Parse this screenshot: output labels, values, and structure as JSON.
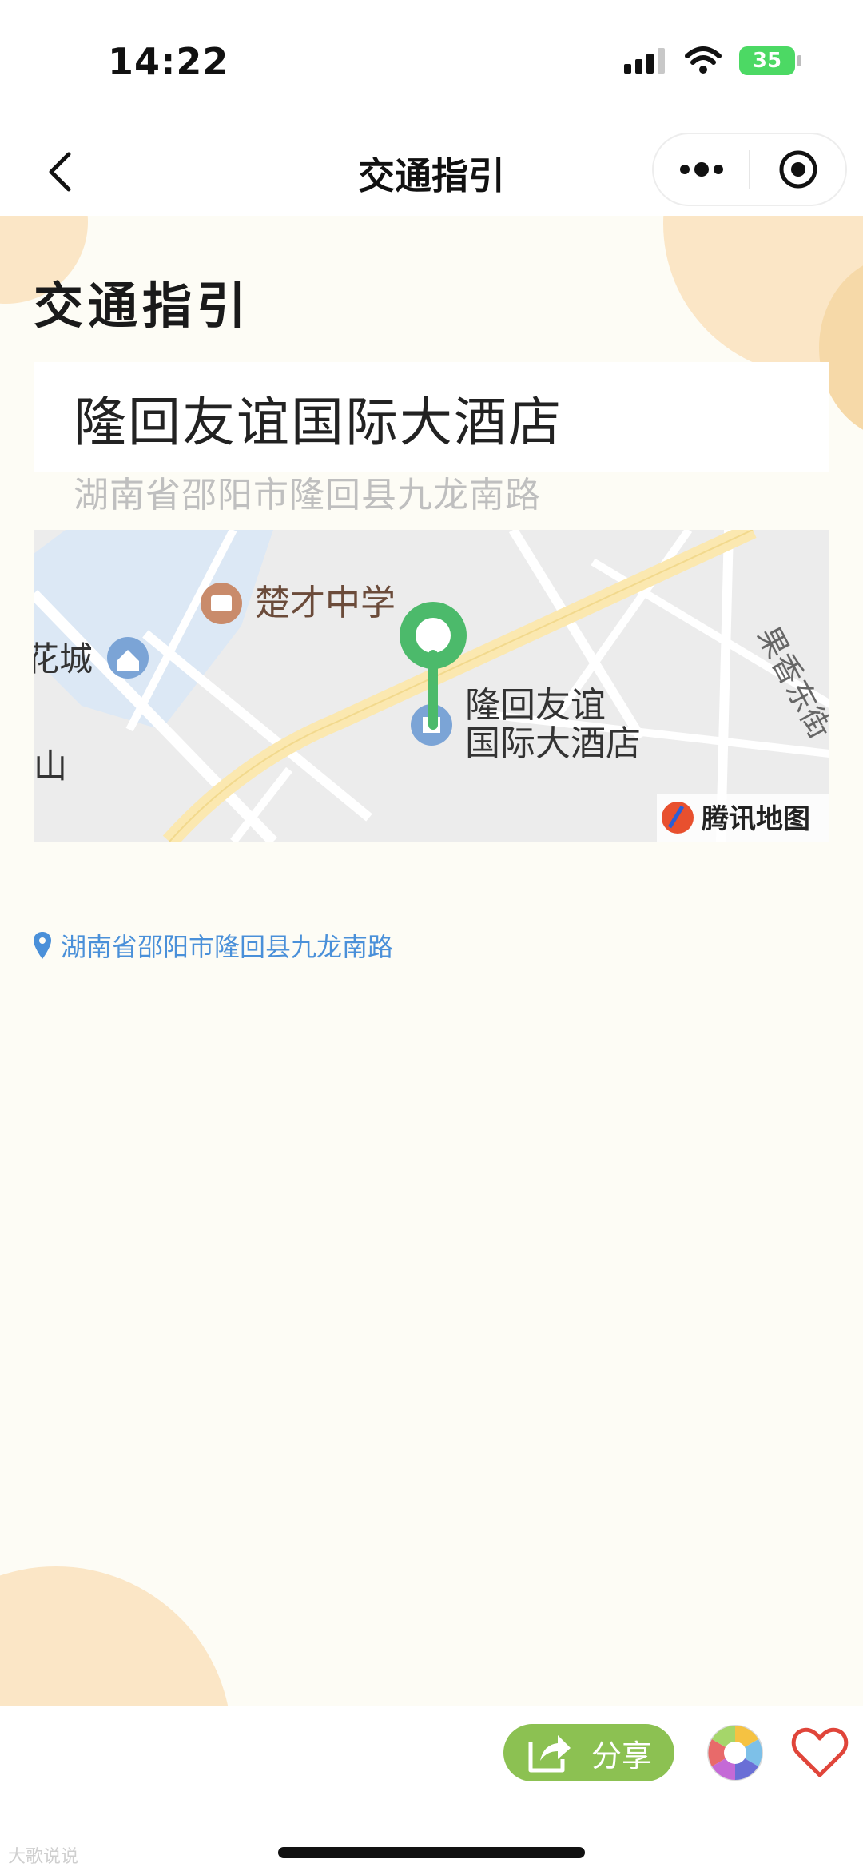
{
  "status_bar": {
    "time": "14:22",
    "battery": "35"
  },
  "nav": {
    "title": "交通指引"
  },
  "page": {
    "heading": "交通指引"
  },
  "venue": {
    "name": "隆回友谊国际大酒店",
    "address": "湖南省邵阳市隆回县九龙南路"
  },
  "map": {
    "labels": {
      "school": "楚才中学",
      "huacheng": "花城",
      "shan": "山",
      "hotel_line1": "隆回友谊",
      "hotel_line2": "国际大酒店",
      "street": "果香东街",
      "provider": "腾讯地图"
    },
    "colors": {
      "pin": "#4cba6b",
      "major_road": "#fbe8b0",
      "water": "#dce8f5"
    }
  },
  "address_link": {
    "text": "湖南省邵阳市隆回县九龙南路"
  },
  "bottom": {
    "share_label": "分享",
    "watermark": "大歌说说"
  },
  "colors": {
    "accent": "#8cc152",
    "link": "#4a90d9",
    "blob": "#fbe6c6",
    "background": "#fdfcf5"
  }
}
